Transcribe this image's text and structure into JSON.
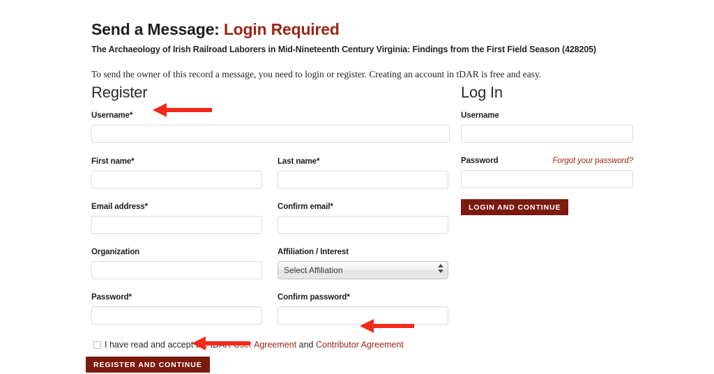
{
  "header": {
    "title_prefix": "Send a Message: ",
    "title_accent": "Login Required",
    "subtitle": "The Archaeology of Irish Railroad Laborers in Mid-Nineteenth Century Virginia: Findings from the First Field Season (428205)",
    "intro": "To send the owner of this record a message, you need to login or register. Creating an account in tDAR is free and easy."
  },
  "register": {
    "heading": "Register",
    "username_label": "Username*",
    "username_value": "",
    "first_name_label": "First name*",
    "first_name_value": "",
    "last_name_label": "Last name*",
    "last_name_value": "",
    "email_label": "Email address*",
    "email_value": "",
    "confirm_email_label": "Confirm email*",
    "confirm_email_value": "",
    "organization_label": "Organization",
    "organization_value": "",
    "affiliation_label": "Affiliation / Interest",
    "affiliation_selected": "Select Affiliation",
    "password_label": "Password*",
    "password_value": "",
    "confirm_password_label": "Confirm password*",
    "confirm_password_value": "",
    "agreement_prefix": "I have read and accept the tDAR ",
    "agreement_link_1": "User Agreement",
    "agreement_middle": " and ",
    "agreement_link_2": "Contributor Agreement",
    "submit_label": "Register and Continue"
  },
  "login": {
    "heading": "Log In",
    "username_label": "Username",
    "username_value": "",
    "password_label": "Password",
    "password_value": "",
    "forgot_label": "Forgot your password?",
    "submit_label": "Login and Continue"
  },
  "annotations": {
    "arrow_username": "arrow-left",
    "arrow_agreement": "arrow-left",
    "arrow_register": "arrow-left"
  },
  "colors": {
    "accent_red": "#9b2616",
    "button_maroon": "#7b1a0f",
    "annotation_red": "#f4291a",
    "input_border": "#d9dbdd",
    "page_background": "#ffffff"
  }
}
